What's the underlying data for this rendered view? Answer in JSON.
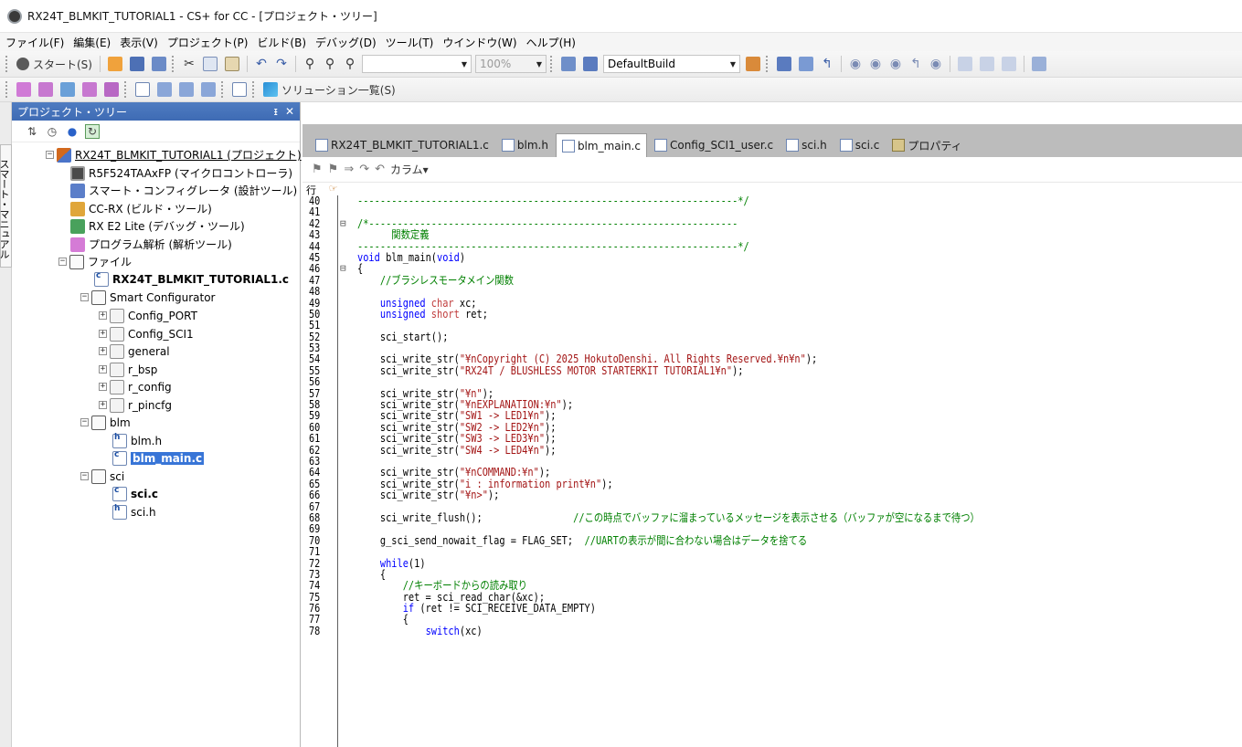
{
  "window": {
    "title": "RX24T_BLMKIT_TUTORIAL1 - CS+ for CC - [プロジェクト・ツリー]"
  },
  "menu": [
    "ファイル(F)",
    "編集(E)",
    "表示(V)",
    "プロジェクト(P)",
    "ビルド(B)",
    "デバッグ(D)",
    "ツール(T)",
    "ウインドウ(W)",
    "ヘルプ(H)"
  ],
  "toolbar": {
    "start_label": "スタート(S)",
    "zoom_value": "100%",
    "build_config": "DefaultBuild",
    "solution_list_label": "ソリューション一覧(S)"
  },
  "side_tab": {
    "label": "スマート・マニュアル"
  },
  "project_tree": {
    "title": "プロジェクト・ツリー",
    "pin": "ᵻ",
    "close": "✕",
    "nodes": [
      {
        "label": "RX24T_BLMKIT_TUTORIAL1 (プロジェクト)"
      },
      {
        "label": "R5F524TAAxFP (マイクロコントローラ)"
      },
      {
        "label": "スマート・コンフィグレータ (設計ツール)"
      },
      {
        "label": "CC-RX (ビルド・ツール)"
      },
      {
        "label": "RX E2 Lite (デバッグ・ツール)"
      },
      {
        "label": "プログラム解析 (解析ツール)"
      },
      {
        "label": "ファイル"
      },
      {
        "label": "RX24T_BLMKIT_TUTORIAL1.c"
      },
      {
        "label": "Smart Configurator"
      },
      {
        "label": "Config_PORT"
      },
      {
        "label": "Config_SCI1"
      },
      {
        "label": "general"
      },
      {
        "label": "r_bsp"
      },
      {
        "label": "r_config"
      },
      {
        "label": "r_pincfg"
      },
      {
        "label": "blm"
      },
      {
        "label": "blm.h"
      },
      {
        "label": "blm_main.c"
      },
      {
        "label": "sci"
      },
      {
        "label": "sci.c"
      },
      {
        "label": "sci.h"
      }
    ]
  },
  "editor_tabs": [
    {
      "label": "RX24T_BLMKIT_TUTORIAL1.c"
    },
    {
      "label": "blm.h"
    },
    {
      "label": "blm_main.c"
    },
    {
      "label": "Config_SCI1_user.c"
    },
    {
      "label": "sci.h"
    },
    {
      "label": "sci.c"
    },
    {
      "label": "プロパティ"
    }
  ],
  "editor_toolbar": {
    "column_label": "カラム▾"
  },
  "gutter": {
    "line_header": "行"
  },
  "code": {
    "line_numbers": [
      "40",
      "41",
      "42",
      "43",
      "44",
      "45",
      "46",
      "47",
      "48",
      "49",
      "50",
      "51",
      "52",
      "53",
      "54",
      "55",
      "56",
      "57",
      "58",
      "59",
      "60",
      "61",
      "62",
      "63",
      "64",
      "65",
      "66",
      "67",
      "68",
      "69",
      "70",
      "71",
      "72",
      "73",
      "74",
      "75",
      "76",
      "77",
      "78"
    ],
    "lines": [
      "-------------------------------------------------------------------*/",
      "",
      "/*-----------------------------------------------------------------",
      "      関数定義",
      "-------------------------------------------------------------------*/",
      "void blm_main(void)",
      "{",
      "    //ブラシレスモータメイン関数",
      "",
      "    unsigned char xc;",
      "    unsigned short ret;",
      "",
      "    sci_start();",
      "",
      "    sci_write_str(\"¥nCopyright (C) 2025 HokutoDenshi. All Rights Reserved.¥n¥n\");",
      "    sci_write_str(\"RX24T / BLUSHLESS MOTOR STARTERKIT TUTORIAL1¥n\");",
      "",
      "    sci_write_str(\"¥n\");",
      "    sci_write_str(\"¥nEXPLANATION:¥n\");",
      "    sci_write_str(\"SW1 -> LED1¥n\");",
      "    sci_write_str(\"SW2 -> LED2¥n\");",
      "    sci_write_str(\"SW3 -> LED3¥n\");",
      "    sci_write_str(\"SW4 -> LED4¥n\");",
      "",
      "    sci_write_str(\"¥nCOMMAND:¥n\");",
      "    sci_write_str(\"i : information print¥n\");",
      "    sci_write_str(\"¥n>\");",
      "",
      "    sci_write_flush();                //この時点でバッファに溜まっているメッセージを表示させる（バッファが空になるまで待つ）",
      "",
      "    g_sci_send_nowait_flag = FLAG_SET;  //UARTの表示が間に合わない場合はデータを捨てる",
      "",
      "    while(1)",
      "    {",
      "        //キーボードからの読み取り",
      "        ret = sci_read_char(&xc);",
      "        if (ret != SCI_RECEIVE_DATA_EMPTY)",
      "        {",
      "            switch(xc)"
    ]
  }
}
